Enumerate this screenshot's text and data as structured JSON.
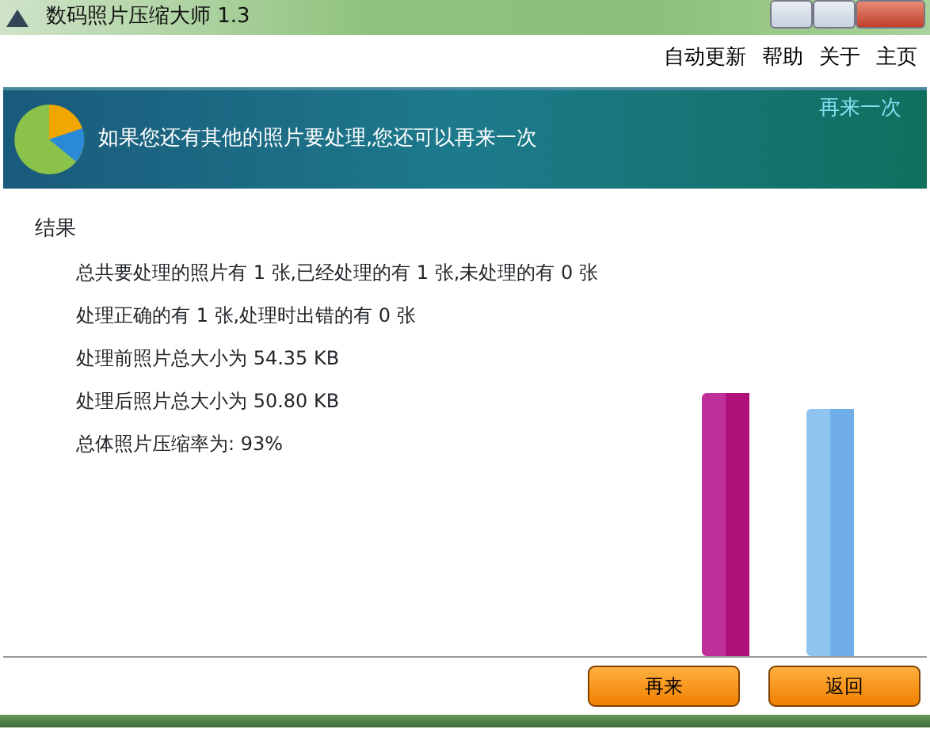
{
  "window": {
    "title": "数码照片压缩大师 1.3"
  },
  "menu": [
    "自动更新",
    "帮助",
    "关于",
    "主页"
  ],
  "banner": {
    "message": "如果您还有其他的照片要处理,您还可以再来一次",
    "link": "再来一次"
  },
  "results": {
    "heading": "结果",
    "lines": [
      "总共要处理的照片有 1 张,已经处理的有 1 张,未处理的有 0 张",
      "处理正确的有 1 张,处理时出错的有 0 张",
      "处理前照片总大小为 54.35 KB",
      "处理后照片总大小为 50.80 KB",
      "总体照片压缩率为: 93%"
    ]
  },
  "buttons": [
    "再来",
    "返回"
  ]
}
